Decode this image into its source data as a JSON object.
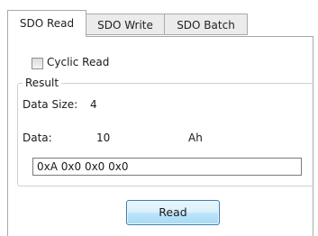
{
  "tabs": [
    {
      "label": "SDO Read",
      "active": true
    },
    {
      "label": "SDO Write",
      "active": false
    },
    {
      "label": "SDO Batch",
      "active": false
    }
  ],
  "cyclic": {
    "label": "Cyclic Read",
    "checked": false
  },
  "result": {
    "title": "Result",
    "data_size_label": "Data Size:",
    "data_size_value": "4",
    "data_label": "Data:",
    "data_value": "10",
    "data_unit": "Ah",
    "bytes": "0xA 0x0 0x0 0x0"
  },
  "read_button": "Read"
}
